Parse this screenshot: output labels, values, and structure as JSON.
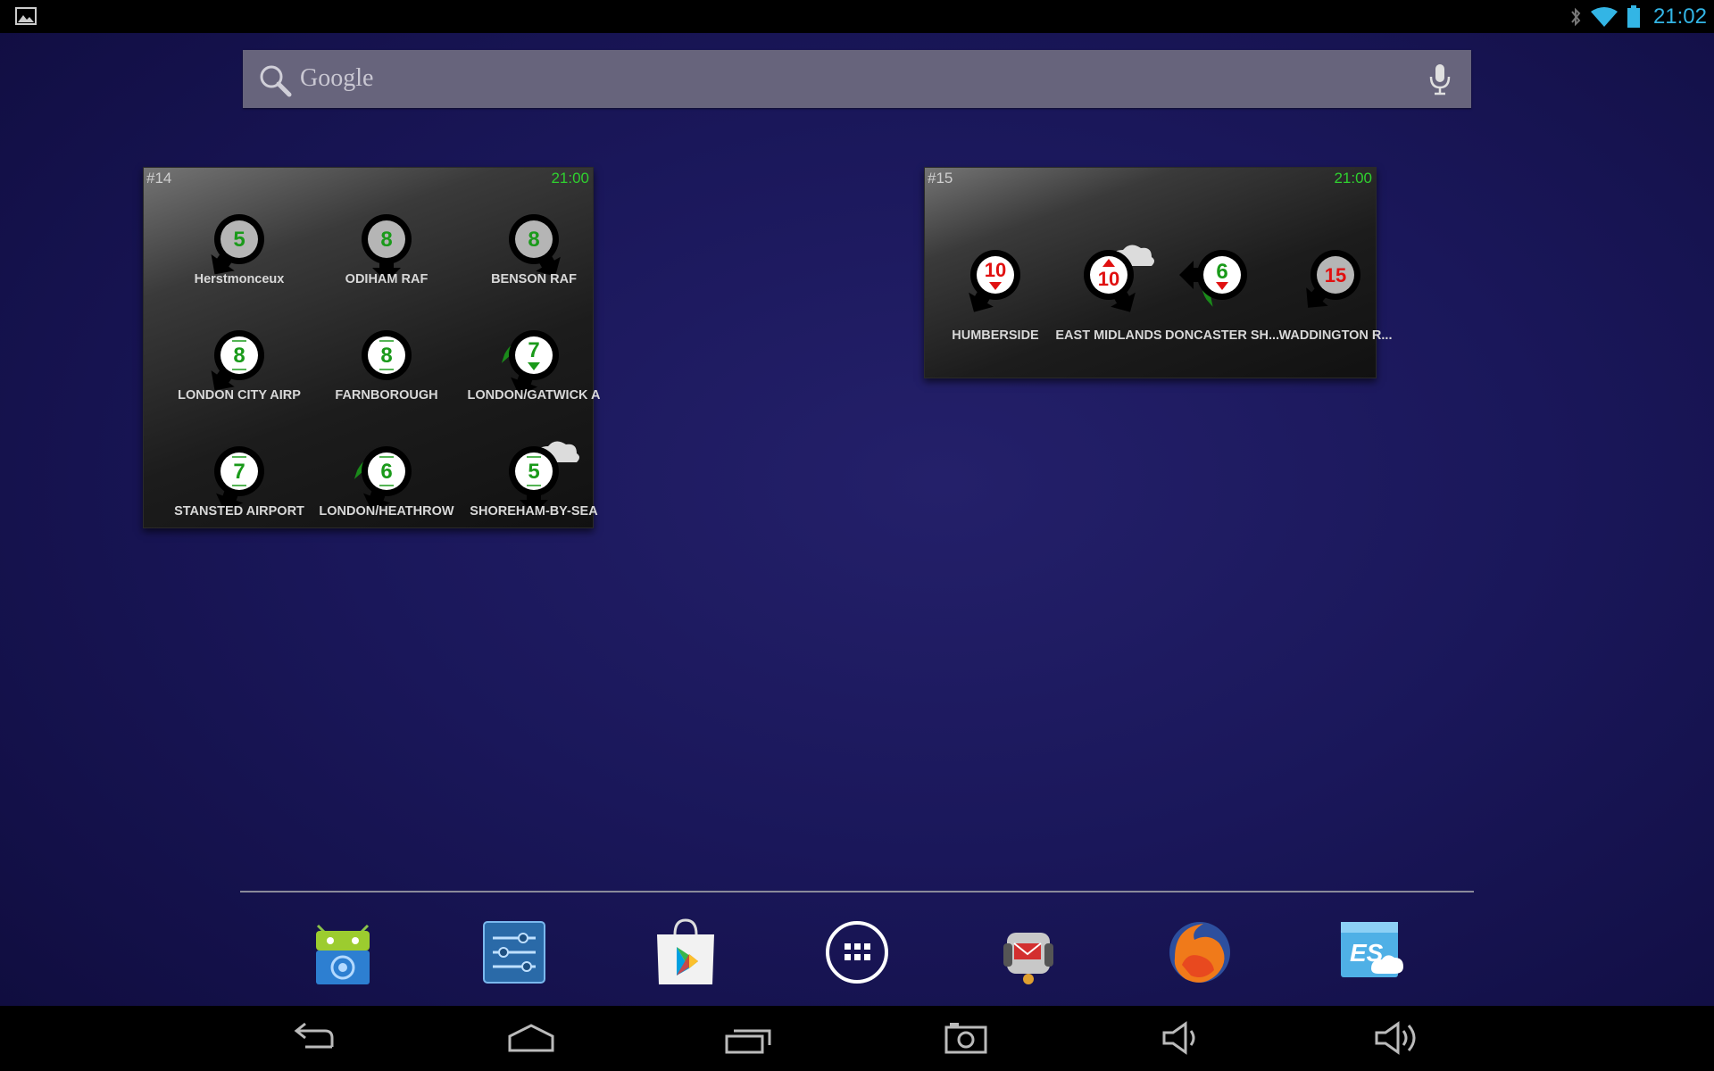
{
  "status_bar": {
    "time": "21:02",
    "icons": [
      "gallery-notification-icon",
      "bluetooth-icon",
      "wifi-icon",
      "battery-icon"
    ]
  },
  "search": {
    "placeholder": "Google",
    "icons": [
      "search-icon",
      "mic-icon"
    ]
  },
  "widgets": [
    {
      "id": "#14",
      "time": "21:00",
      "stations": [
        {
          "name": "Herstmonceux",
          "value": "5"
        },
        {
          "name": "ODIHAM RAF",
          "value": "8"
        },
        {
          "name": "BENSON RAF",
          "value": "8"
        },
        {
          "name": "LONDON CITY AIRP",
          "value": "8"
        },
        {
          "name": "FARNBOROUGH",
          "value": "8"
        },
        {
          "name": "LONDON/GATWICK A",
          "value": "7"
        },
        {
          "name": "STANSTED AIRPORT",
          "value": "7"
        },
        {
          "name": "LONDON/HEATHROW",
          "value": "6"
        },
        {
          "name": "SHOREHAM-BY-SEA",
          "value": "5"
        }
      ]
    },
    {
      "id": "#15",
      "time": "21:00",
      "stations": [
        {
          "name": "HUMBERSIDE",
          "value": "10"
        },
        {
          "name": "EAST MIDLANDS",
          "value": "10"
        },
        {
          "name": "DONCASTER SH...",
          "value": "6"
        },
        {
          "name": "WADDINGTON R...",
          "value": "15"
        }
      ]
    }
  ],
  "dock": [
    "f-droid-app-icon",
    "settings-app-icon",
    "play-store-app-icon",
    "app-drawer-icon",
    "k9-mail-app-icon",
    "firefox-app-icon",
    "es-file-explorer-app-icon"
  ],
  "nav": [
    "back-icon",
    "home-icon",
    "recents-icon",
    "screenshot-icon",
    "volume-down-icon",
    "volume-up-icon"
  ],
  "colors": {
    "accent": "#33b5e5",
    "widget_time": "#2fd02f",
    "wind_green": "#1a9a1a",
    "wind_red": "#e01010"
  }
}
